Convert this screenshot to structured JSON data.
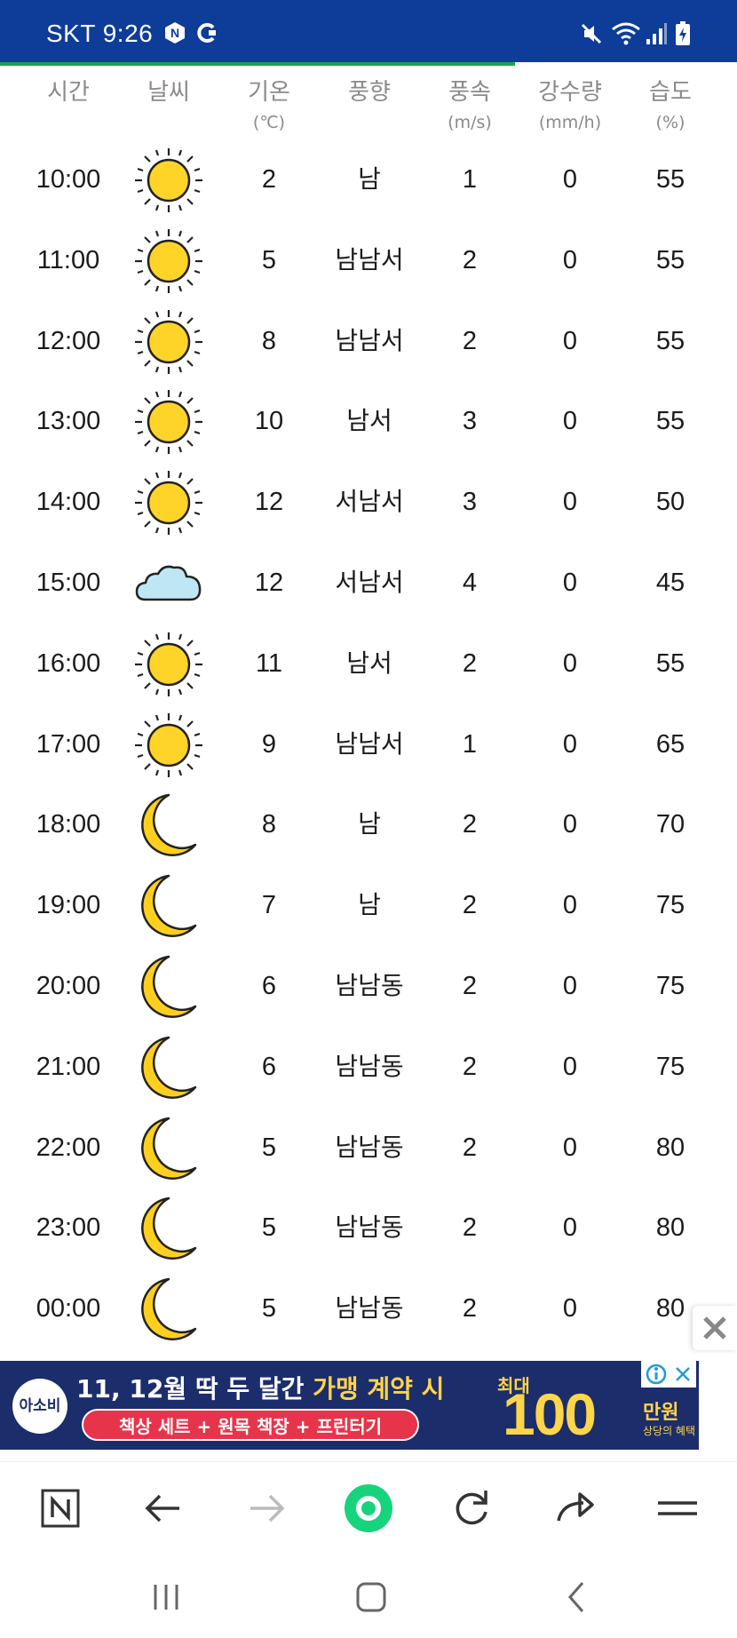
{
  "status_bar": {
    "carrier_time": "SKT 9:26"
  },
  "table": {
    "headers": [
      {
        "label": "시간",
        "unit": ""
      },
      {
        "label": "날씨",
        "unit": ""
      },
      {
        "label": "기온",
        "unit": "(℃)"
      },
      {
        "label": "풍향",
        "unit": ""
      },
      {
        "label": "풍속",
        "unit": "(m/s)"
      },
      {
        "label": "강수량",
        "unit": "(mm/h)"
      },
      {
        "label": "습도",
        "unit": "(%)"
      }
    ],
    "rows": [
      {
        "time": "10:00",
        "weather": "sun-icon",
        "temp": "2",
        "wind_dir": "남",
        "wind_speed": "1",
        "precip": "0",
        "humidity": "55"
      },
      {
        "time": "11:00",
        "weather": "sun-icon",
        "temp": "5",
        "wind_dir": "남남서",
        "wind_speed": "2",
        "precip": "0",
        "humidity": "55"
      },
      {
        "time": "12:00",
        "weather": "sun-icon",
        "temp": "8",
        "wind_dir": "남남서",
        "wind_speed": "2",
        "precip": "0",
        "humidity": "55"
      },
      {
        "time": "13:00",
        "weather": "sun-icon",
        "temp": "10",
        "wind_dir": "남서",
        "wind_speed": "3",
        "precip": "0",
        "humidity": "55"
      },
      {
        "time": "14:00",
        "weather": "sun-icon",
        "temp": "12",
        "wind_dir": "서남서",
        "wind_speed": "3",
        "precip": "0",
        "humidity": "50"
      },
      {
        "time": "15:00",
        "weather": "cloud-icon",
        "temp": "12",
        "wind_dir": "서남서",
        "wind_speed": "4",
        "precip": "0",
        "humidity": "45"
      },
      {
        "time": "16:00",
        "weather": "sun-icon",
        "temp": "11",
        "wind_dir": "남서",
        "wind_speed": "2",
        "precip": "0",
        "humidity": "55"
      },
      {
        "time": "17:00",
        "weather": "sun-icon",
        "temp": "9",
        "wind_dir": "남남서",
        "wind_speed": "1",
        "precip": "0",
        "humidity": "65"
      },
      {
        "time": "18:00",
        "weather": "moon-icon",
        "temp": "8",
        "wind_dir": "남",
        "wind_speed": "2",
        "precip": "0",
        "humidity": "70"
      },
      {
        "time": "19:00",
        "weather": "moon-icon",
        "temp": "7",
        "wind_dir": "남",
        "wind_speed": "2",
        "precip": "0",
        "humidity": "75"
      },
      {
        "time": "20:00",
        "weather": "moon-icon",
        "temp": "6",
        "wind_dir": "남남동",
        "wind_speed": "2",
        "precip": "0",
        "humidity": "75"
      },
      {
        "time": "21:00",
        "weather": "moon-icon",
        "temp": "6",
        "wind_dir": "남남동",
        "wind_speed": "2",
        "precip": "0",
        "humidity": "75"
      },
      {
        "time": "22:00",
        "weather": "moon-icon",
        "temp": "5",
        "wind_dir": "남남동",
        "wind_speed": "2",
        "precip": "0",
        "humidity": "80"
      },
      {
        "time": "23:00",
        "weather": "moon-icon",
        "temp": "5",
        "wind_dir": "남남동",
        "wind_speed": "2",
        "precip": "0",
        "humidity": "80"
      },
      {
        "time": "00:00",
        "weather": "moon-icon",
        "temp": "5",
        "wind_dir": "남남동",
        "wind_speed": "2",
        "precip": "0",
        "humidity": "80"
      }
    ]
  },
  "ad": {
    "brand": "아소비",
    "headline_a": "11, 12월 딱 두 달간 ",
    "headline_b": "가맹 계약 시",
    "pill": "책상 세트 + 원목 책장 + 프린터기",
    "max_label": "최대",
    "amount": "100",
    "unit": "만원",
    "sub": "상당의 혜택"
  },
  "colors": {
    "status_bar": "#0d3c99",
    "page_progress": "#1aa64a",
    "sun": "#ffd428",
    "moon": "#ffcf1f",
    "cloud": "#bfe6f5",
    "header_text": "#8a8a8a",
    "home_accent": "#16d47b"
  }
}
